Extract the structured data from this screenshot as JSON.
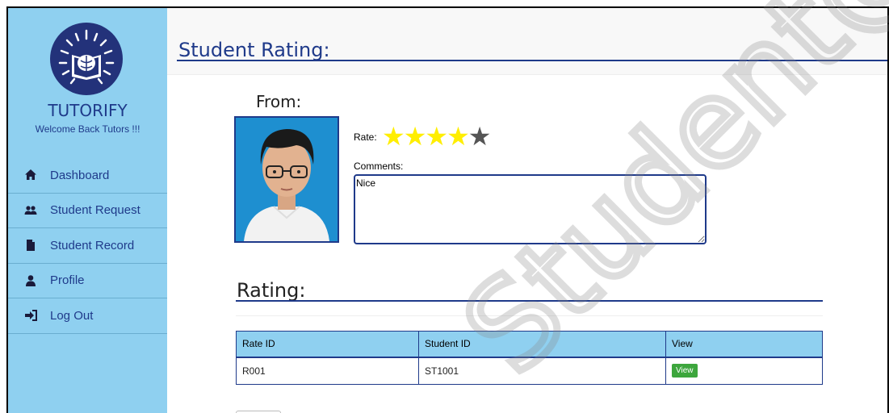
{
  "sidebar": {
    "brand": "TUTORIFY",
    "welcome": "Welcome Back Tutors !!!",
    "items": [
      {
        "label": "Dashboard",
        "icon": "home-icon"
      },
      {
        "label": "Student Request",
        "icon": "users-icon"
      },
      {
        "label": "Student Record",
        "icon": "file-icon"
      },
      {
        "label": "Profile",
        "icon": "user-icon"
      },
      {
        "label": "Log Out",
        "icon": "sign-out-icon"
      }
    ]
  },
  "main": {
    "title": "Student Rating:",
    "from_label": "From:",
    "rate_label": "Rate:",
    "rating_value": 4,
    "rating_max": 5,
    "comments_label": "Comments:",
    "comments_value": "Nice",
    "rating_title": "Rating:",
    "table": {
      "headers": [
        "Rate ID",
        "Student ID",
        "View"
      ],
      "rows": [
        {
          "rate_id": "R001",
          "student_id": "ST1001",
          "view": "View"
        }
      ]
    }
  },
  "watermark": "Student@FTSM",
  "colors": {
    "sidebar_bg": "#8fd0f0",
    "accent": "#1f3a8a",
    "star_on": "#ffee00",
    "star_off": "#555555",
    "view_button": "#3da63d"
  }
}
